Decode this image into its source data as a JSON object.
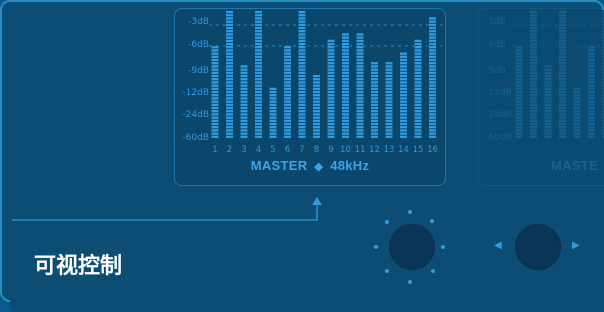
{
  "section_title": "可视控制",
  "eq_panel": {
    "db_labels": [
      "-3dB",
      "-6dB",
      "-9dB",
      "-12dB",
      "-24dB",
      "-60dB"
    ],
    "band_labels": [
      "1",
      "2",
      "3",
      "4",
      "5",
      "6",
      "7",
      "8",
      "9",
      "10",
      "11",
      "12",
      "13",
      "14",
      "15",
      "16"
    ],
    "band_levels": [
      0.73,
      1.0,
      0.58,
      1.0,
      0.39,
      0.73,
      1.0,
      0.49,
      0.79,
      0.82,
      0.82,
      0.61,
      0.61,
      0.67,
      0.79,
      0.97
    ],
    "master_label": "MASTER",
    "separator_glyph": "◆",
    "sample_rate": "48kHz"
  },
  "ghost_panel": {
    "db_labels": [
      "-3dB",
      "-6dB",
      "-9dB",
      "-12dB",
      "-24dB",
      "-60dB"
    ],
    "band_levels": [
      0.73,
      1.0,
      0.58,
      1.0,
      0.39,
      0.73,
      1.0
    ],
    "caption_fragment": "MASTE"
  },
  "knob_left": {
    "icon": "rotary-knob"
  },
  "knob_right": {
    "icon": "rotary-knob",
    "left_arrow": "◀",
    "right_arrow": "▶"
  },
  "colors": {
    "accent": "#2f9be0",
    "bar": "#2f9be0",
    "background": "#0b4f79",
    "title": "#ffffff"
  }
}
